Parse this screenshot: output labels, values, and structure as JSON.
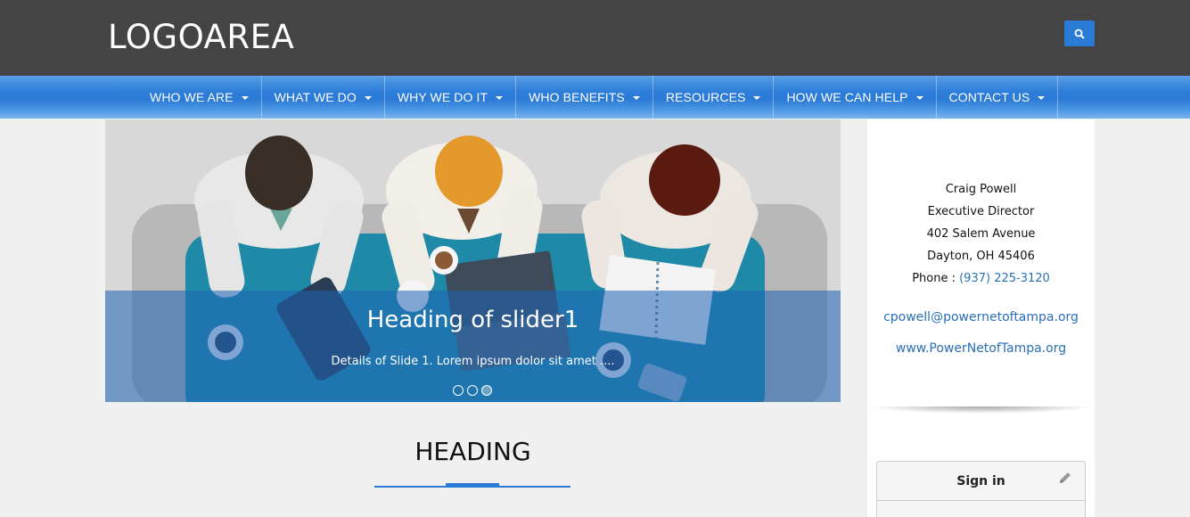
{
  "header": {
    "logo": "LOGOAREA",
    "search_icon": "search-icon"
  },
  "nav": {
    "items": [
      {
        "label": "WHO WE ARE"
      },
      {
        "label": "WHAT WE DO"
      },
      {
        "label": "WHY WE DO IT"
      },
      {
        "label": "WHO BENEFITS"
      },
      {
        "label": "RESOURCES"
      },
      {
        "label": "HOW WE CAN HELP"
      },
      {
        "label": "CONTACT US"
      }
    ]
  },
  "slider": {
    "heading": "Heading of slider1",
    "detail": "Details of Slide 1. Lorem ipsum dolor sit amet ....",
    "slide_count": 3,
    "active_slide": 3
  },
  "main": {
    "heading": "HEADING"
  },
  "sidebar": {
    "name": "Craig Powell",
    "title": "Executive Director",
    "address": "402 Salem Avenue",
    "city": "Dayton, OH 45406",
    "phone_label": "Phone : ",
    "phone": "(937) 225-3120",
    "email": "cpowell@powernetoftampa.org",
    "website": "www.PowerNetofTampa.org",
    "signin": {
      "title": "Sign in",
      "icon": "pencil-icon"
    }
  },
  "colors": {
    "topbar": "#444444",
    "accent": "#2a7bd6",
    "link": "#2a6fb5"
  }
}
